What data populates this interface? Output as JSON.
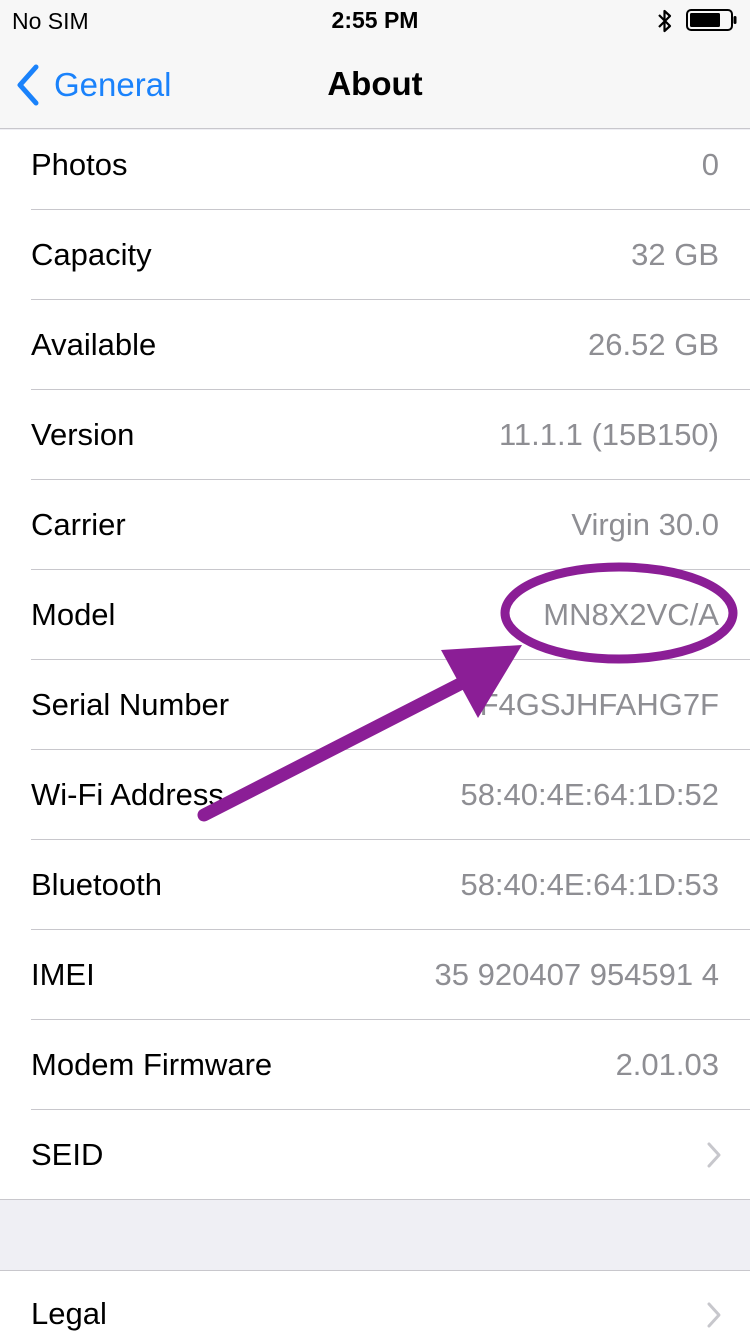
{
  "status_bar": {
    "carrier": "No SIM",
    "time": "2:55 PM",
    "bluetooth_icon": "bluetooth-icon",
    "battery_icon": "battery-icon"
  },
  "nav": {
    "back_label": "General",
    "title": "About",
    "accent_color": "#1a82fb"
  },
  "rows": [
    {
      "label": "Photos",
      "value": "0"
    },
    {
      "label": "Capacity",
      "value": "32 GB"
    },
    {
      "label": "Available",
      "value": "26.52 GB"
    },
    {
      "label": "Version",
      "value": "11.1.1 (15B150)"
    },
    {
      "label": "Carrier",
      "value": "Virgin 30.0"
    },
    {
      "label": "Model",
      "value": "MN8X2VC/A"
    },
    {
      "label": "Serial Number",
      "value": "F4GSJHFAHG7F"
    },
    {
      "label": "Wi-Fi Address",
      "value": "58:40:4E:64:1D:52"
    },
    {
      "label": "Bluetooth",
      "value": "58:40:4E:64:1D:53"
    },
    {
      "label": "IMEI",
      "value": "35 920407 954591 4"
    },
    {
      "label": "Modem Firmware",
      "value": "2.01.03"
    },
    {
      "label": "SEID",
      "value": ""
    }
  ],
  "legal": {
    "label": "Legal"
  },
  "annotation": {
    "color": "#8b1e96"
  }
}
